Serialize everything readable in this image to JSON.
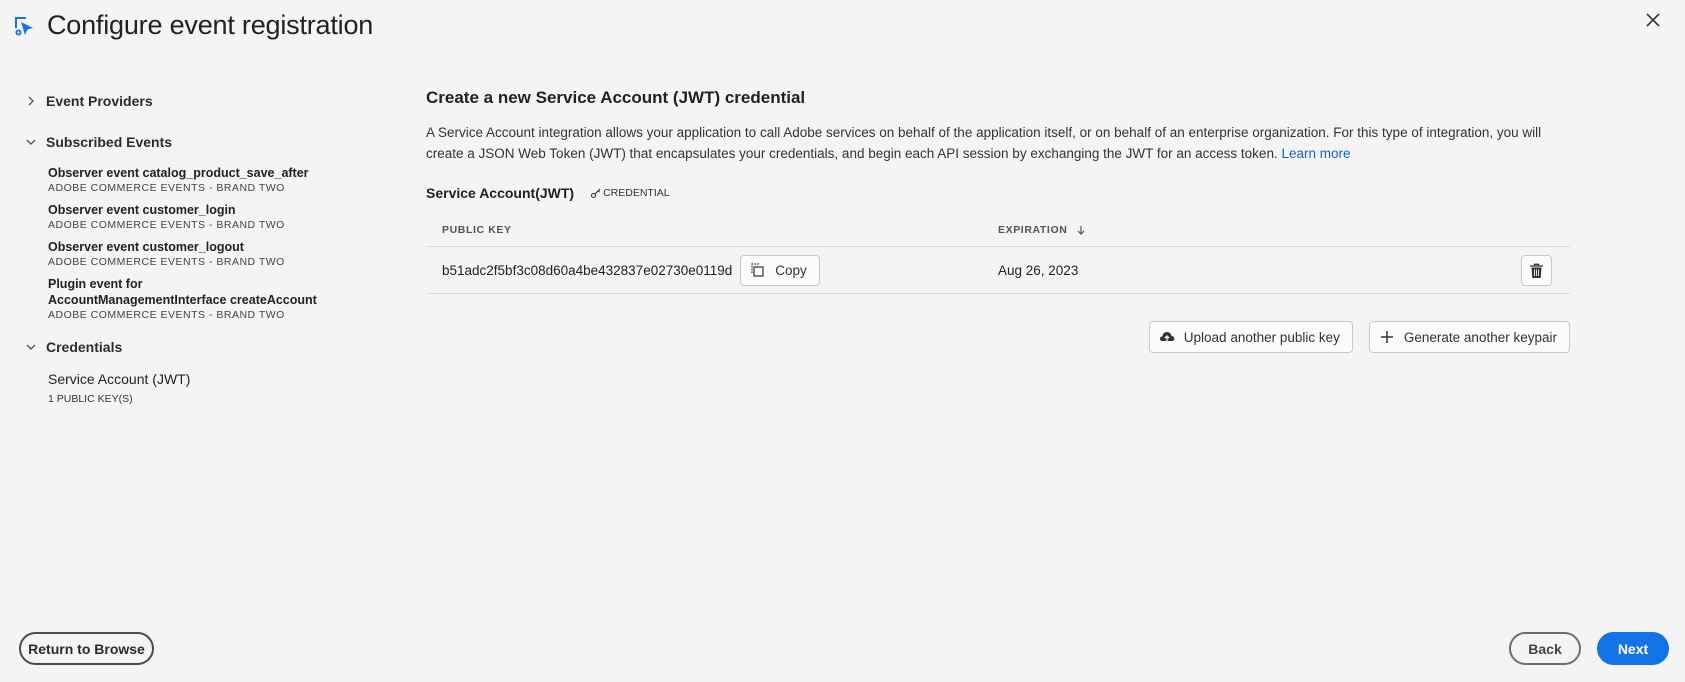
{
  "header": {
    "title": "Configure event registration",
    "app_icon": "event-cursor-gear-icon",
    "close_icon": "close-icon"
  },
  "sidebar": {
    "sections": [
      {
        "label": "Event Providers",
        "expanded": false
      },
      {
        "label": "Subscribed Events",
        "expanded": true
      },
      {
        "label": "Credentials",
        "expanded": true
      }
    ],
    "events": [
      {
        "title": "Observer event catalog_product_save_after",
        "provider": "ADOBE COMMERCE EVENTS - BRAND TWO"
      },
      {
        "title": "Observer event customer_login",
        "provider": "ADOBE COMMERCE EVENTS - BRAND TWO"
      },
      {
        "title": "Observer event customer_logout",
        "provider": "ADOBE COMMERCE EVENTS - BRAND TWO"
      },
      {
        "title": "Plugin event for AccountManagementInterface createAccount",
        "provider": "ADOBE COMMERCE EVENTS - BRAND TWO"
      }
    ],
    "credential": {
      "title": "Service Account (JWT)",
      "sub": "1 PUBLIC KEY(S)"
    }
  },
  "main": {
    "heading": "Create a new Service Account (JWT) credential",
    "description": "A Service Account integration allows your application to call Adobe services on behalf of the application itself, or on behalf of an enterprise organization. For this type of integration, you will create a JSON Web Token (JWT) that encapsulates your credentials, and begin each API session by exchanging the JWT for an access token.",
    "learn_more": "Learn more",
    "sa_label": "Service Account(JWT)",
    "badge": "CREDENTIAL",
    "table": {
      "col_key": "PUBLIC KEY",
      "col_exp": "EXPIRATION",
      "rows": [
        {
          "key": "b51adc2f5bf3c08d60a4be432837e02730e0119d",
          "expiration": "Aug 26, 2023"
        }
      ]
    },
    "copy_label": "Copy",
    "upload_label": "Upload another public key",
    "generate_label": "Generate another keypair"
  },
  "footer": {
    "return_label": "Return to Browse",
    "back_label": "Back",
    "next_label": "Next"
  },
  "colors": {
    "accent": "#1473e6",
    "link": "#1464c8",
    "background": "#f4f4f4"
  }
}
